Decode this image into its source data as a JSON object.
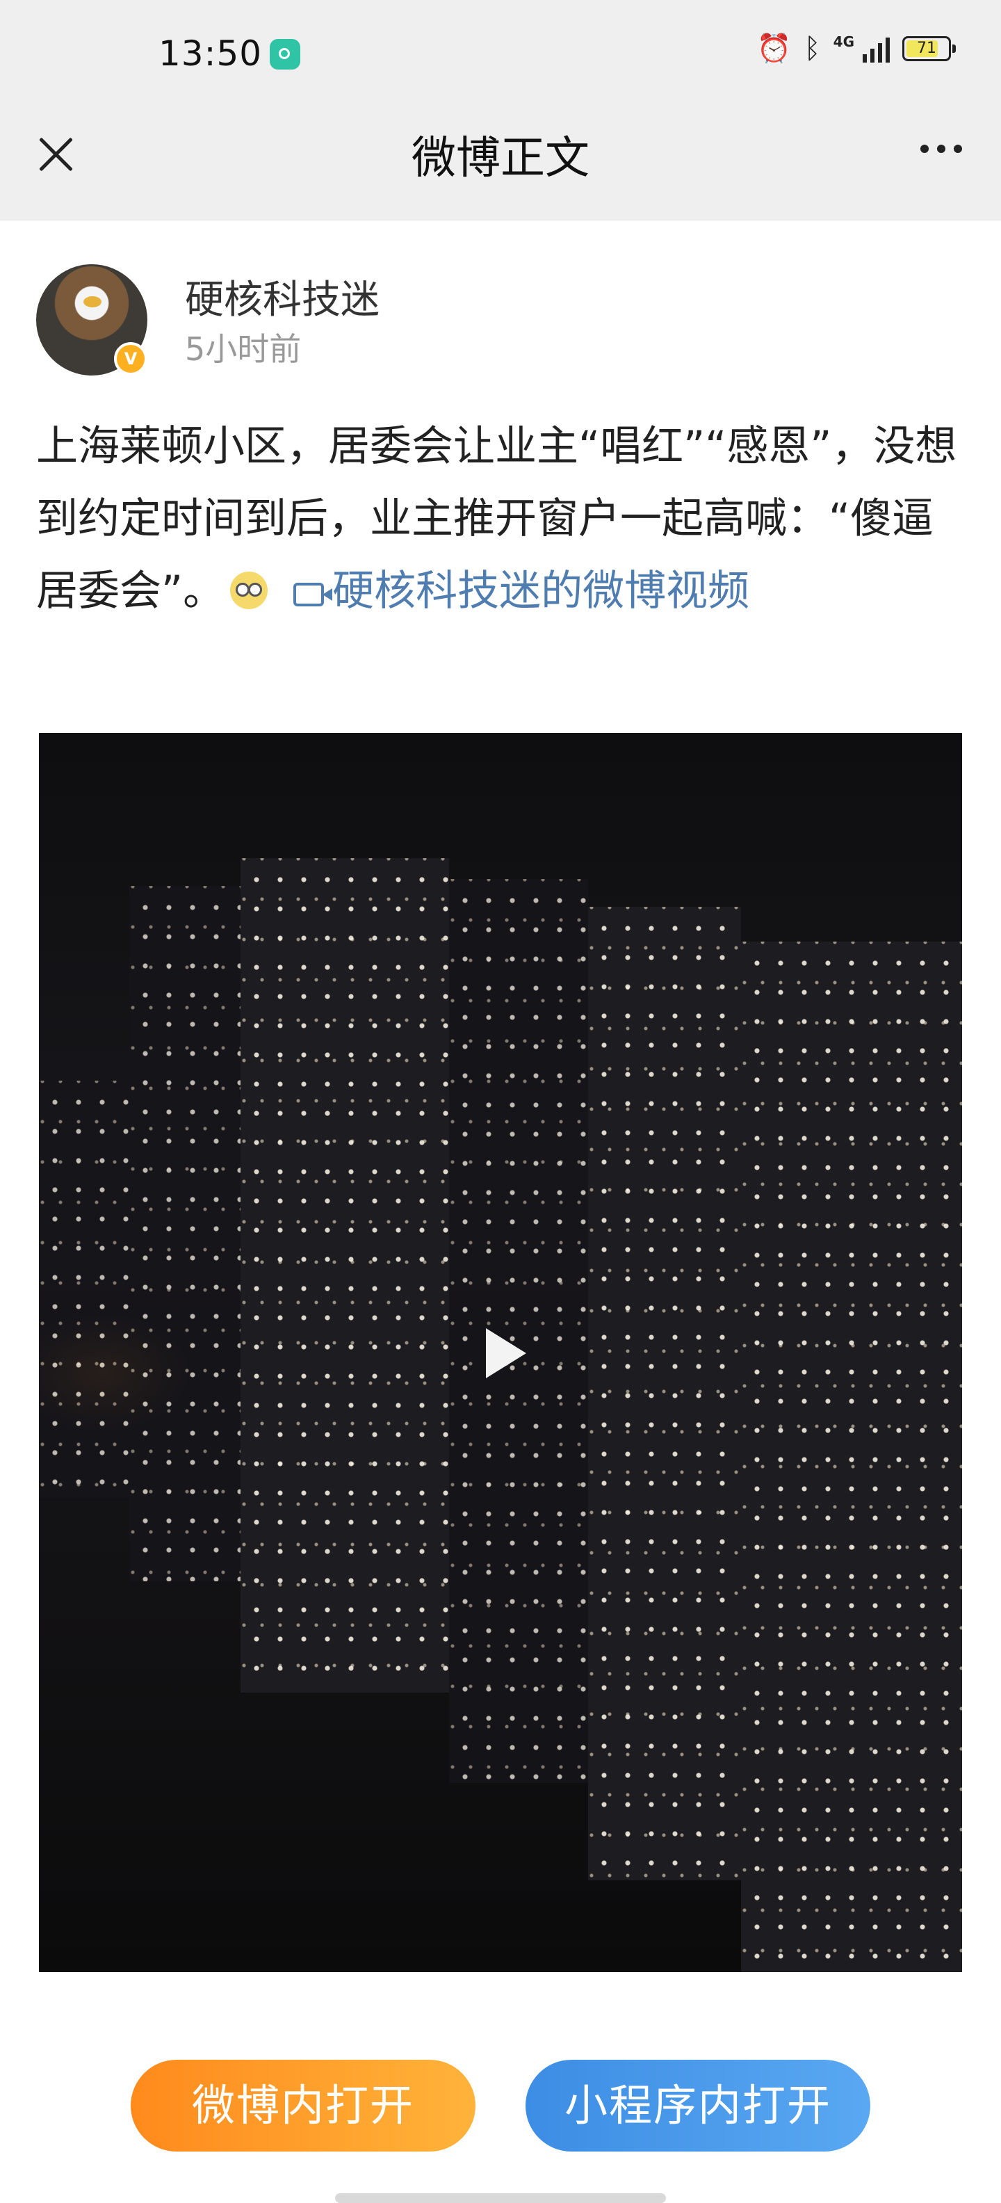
{
  "status_bar": {
    "time": "13:50",
    "network": "4G",
    "battery_level": "71",
    "icons": [
      "app-notification-icon",
      "alarm-icon",
      "bluetooth-icon",
      "signal-icon",
      "battery-icon"
    ]
  },
  "nav": {
    "title": "微博正文",
    "close_icon": "close-icon",
    "more_icon": "more-icon"
  },
  "post": {
    "author_name": "硬核科技迷",
    "time_ago": "5小时前",
    "verified": true,
    "verified_color": "#ffb021",
    "text_before_emoji": "上海莱顿小区，居委会让业主“唱红”“感恩”，没想到约定时间到后，业主推开窗户一起高喊：“傻逼居委会”。",
    "emoji_icon": "sly-emoji-icon",
    "video_link_text": "硬核科技迷的微博视频",
    "link_color": "#507daf"
  },
  "video": {
    "play_icon": "play-icon"
  },
  "actions": {
    "open_weibo_label": "微博内打开",
    "open_miniprogram_label": "小程序内打开",
    "open_weibo_color": "#ff8a1c",
    "open_miniprogram_color": "#3c8de4"
  }
}
